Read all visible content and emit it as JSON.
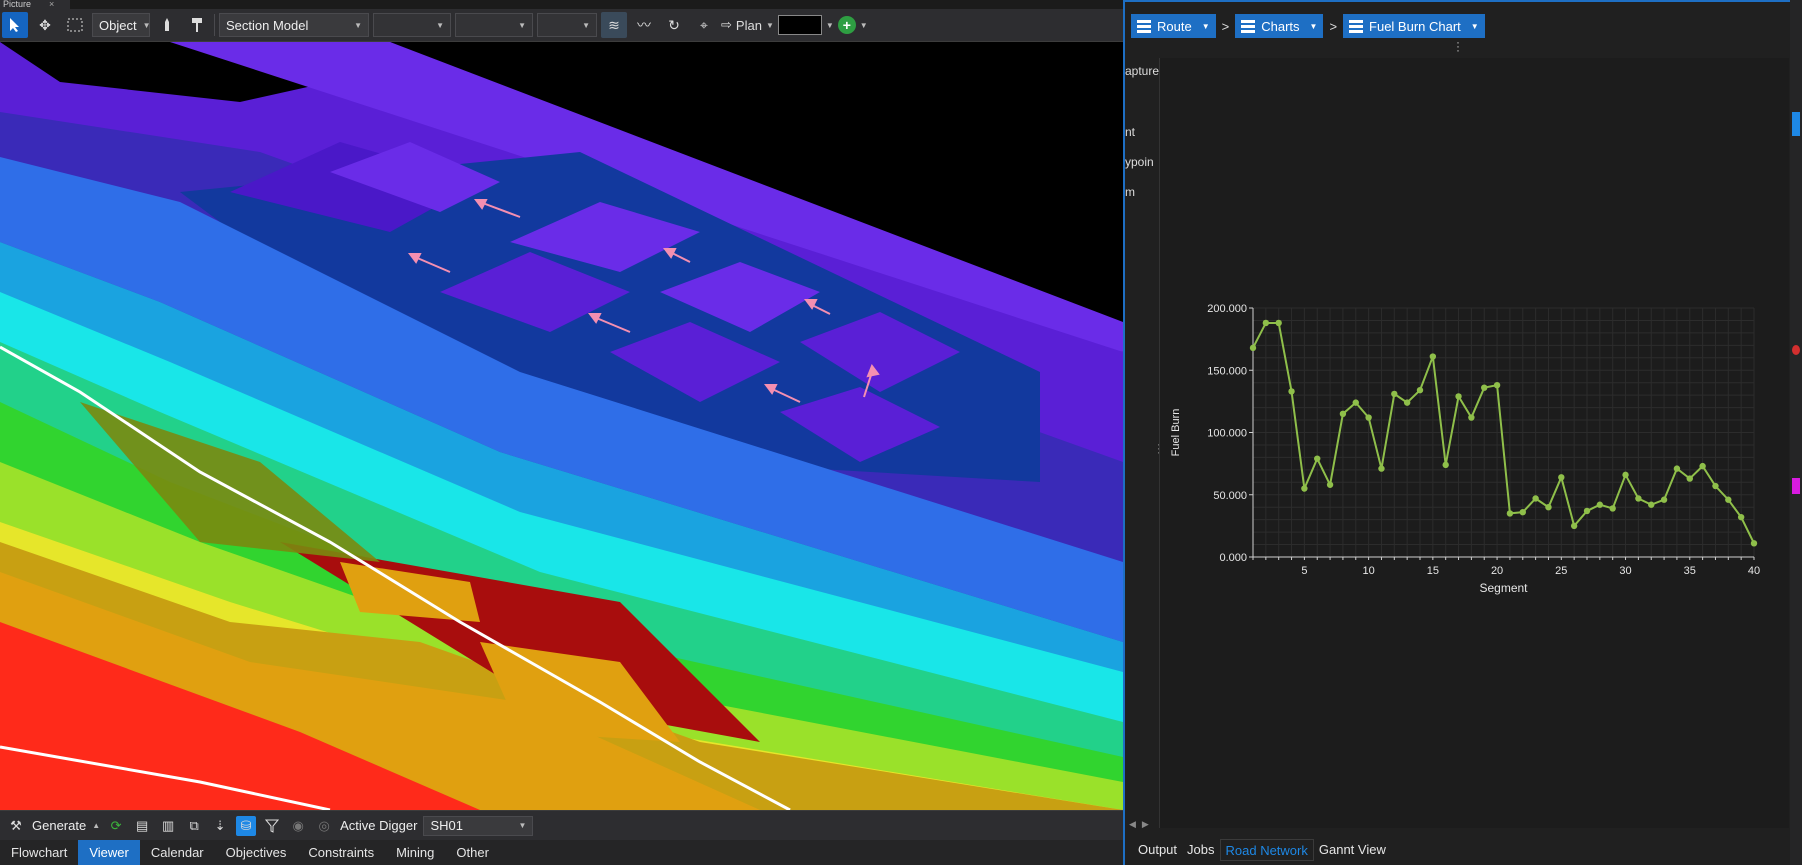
{
  "viewer": {
    "tab_title": "Picture",
    "toolbar": {
      "mode_dropdown": "Object",
      "model_dropdown": "Section Model",
      "view_label": "Plan"
    },
    "bottom_toolbar": {
      "generate_label": "Generate",
      "active_digger_label": "Active Digger",
      "active_digger_value": "SH01"
    },
    "bottom_tabs": [
      "Flowchart",
      "Viewer",
      "Calendar",
      "Objectives",
      "Constraints",
      "Mining",
      "Other"
    ],
    "active_bottom_tab": "Viewer"
  },
  "panel": {
    "breadcrumb": [
      "Route",
      "Charts",
      "Fuel Burn Chart"
    ],
    "side_labels": [
      "apture",
      "nt",
      "ypoin",
      "m"
    ],
    "tabs": [
      "Output",
      "Jobs",
      "Road Network",
      "Gannt View"
    ],
    "active_tab": "Road Network"
  },
  "colors": {
    "accent": "#1e6fc4",
    "series": "#8fbf4a"
  },
  "chart_data": {
    "type": "line",
    "title": "",
    "xlabel": "Segment",
    "ylabel": "Fuel Burn",
    "xlim": [
      1,
      40
    ],
    "ylim": [
      0,
      200000
    ],
    "x_ticks": [
      5,
      10,
      15,
      20,
      25,
      30,
      35,
      40
    ],
    "y_ticks": [
      "0.000",
      "50.000",
      "100.000",
      "150.000",
      "200.000"
    ],
    "y_tick_values": [
      0,
      50000,
      100000,
      150000,
      200000
    ],
    "grid": true,
    "series": [
      {
        "x": [
          1,
          2,
          3,
          4,
          5,
          6,
          7,
          8,
          9,
          10,
          11,
          12,
          13,
          14,
          15,
          16,
          17,
          18,
          19,
          20,
          21,
          22,
          23,
          24,
          25,
          26,
          27,
          28,
          29,
          30,
          31,
          32,
          33,
          34,
          35,
          36,
          37,
          38,
          39,
          40
        ],
        "values": [
          168000,
          188000,
          188000,
          133000,
          55000,
          79000,
          58000,
          115000,
          124000,
          112000,
          71000,
          131000,
          124000,
          134000,
          161000,
          74000,
          129000,
          112000,
          136000,
          138000,
          35000,
          36000,
          47000,
          40000,
          64000,
          25000,
          37000,
          42000,
          39000,
          66000,
          47000,
          42000,
          46000,
          71000,
          63000,
          73000,
          57000,
          46000,
          32000,
          11000
        ]
      }
    ]
  }
}
